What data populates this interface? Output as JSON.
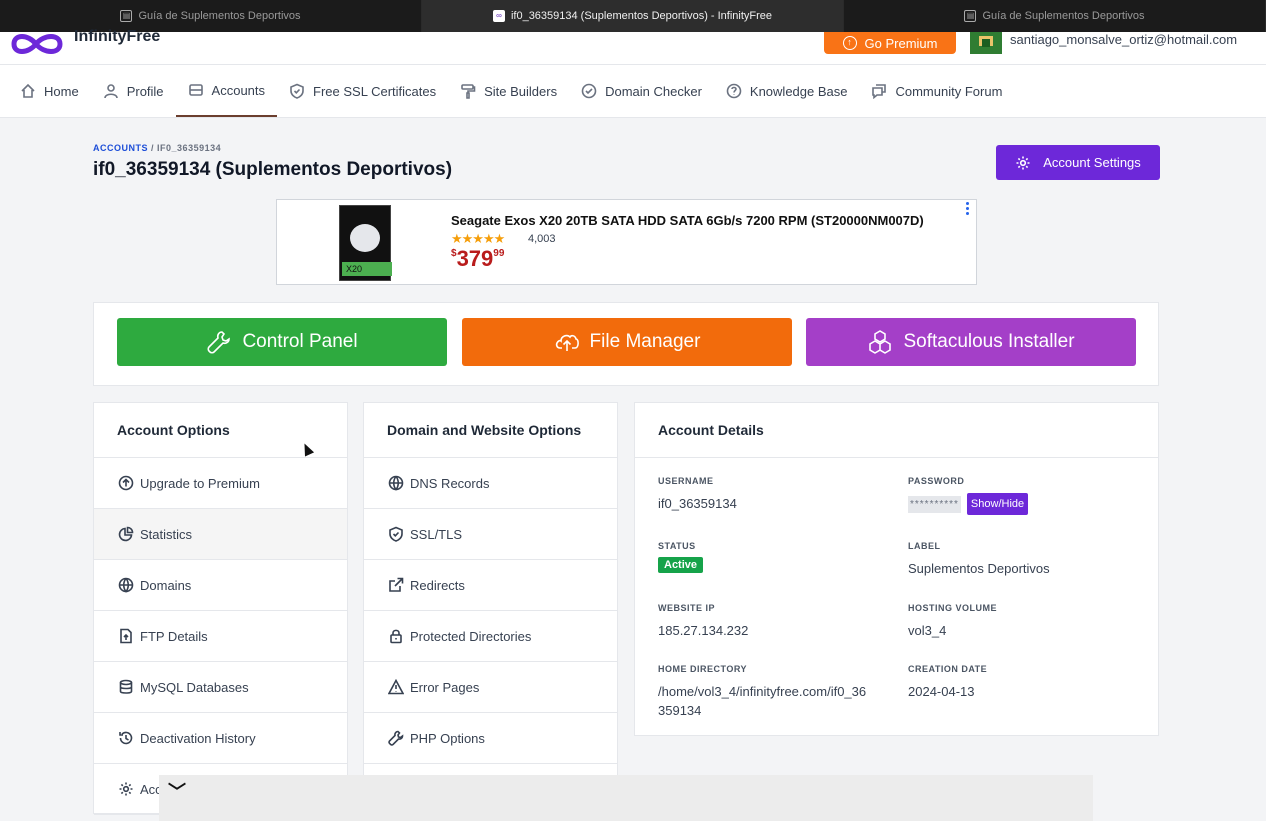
{
  "browser": {
    "tabs": [
      {
        "label": "Guía de Suplementos Deportivos"
      },
      {
        "label": "if0_36359134 (Suplementos Deportivos) - InfinityFree"
      },
      {
        "label": "Guía de Suplementos Deportivos"
      }
    ]
  },
  "header": {
    "brand": "InfinityFree",
    "premium_label": "Go Premium",
    "user_email": "santiago_monsalve_ortiz@hotmail.com"
  },
  "nav": {
    "items": [
      {
        "label": "Home",
        "icon": "home-icon"
      },
      {
        "label": "Profile",
        "icon": "user-icon"
      },
      {
        "label": "Accounts",
        "icon": "server-icon"
      },
      {
        "label": "Free SSL Certificates",
        "icon": "shield-icon"
      },
      {
        "label": "Site Builders",
        "icon": "paint-roller-icon"
      },
      {
        "label": "Domain Checker",
        "icon": "check-circle-icon"
      },
      {
        "label": "Knowledge Base",
        "icon": "question-circle-icon"
      },
      {
        "label": "Community Forum",
        "icon": "chat-icon"
      }
    ],
    "active": "Accounts"
  },
  "page": {
    "breadcrumb_root": "ACCOUNTS",
    "breadcrumb_sep": "/",
    "breadcrumb_current": "IF0_36359134",
    "title": "if0_36359134 (Suplementos Deportivos)",
    "settings_label": "Account Settings"
  },
  "ad": {
    "title": "Seagate Exos X20 20TB SATA HDD SATA 6Gb/s 7200 RPM (ST20000NM007D)",
    "stars": "★★★★★",
    "rating_count": "4,003",
    "price_symbol": "$",
    "price_whole": "379",
    "price_cents": "99"
  },
  "actions": {
    "control_panel": "Control Panel",
    "file_manager": "File Manager",
    "softaculous": "Softaculous Installer"
  },
  "account_options": {
    "heading": "Account Options",
    "items": [
      {
        "label": "Upgrade to Premium",
        "icon": "arrow-up-circle-icon"
      },
      {
        "label": "Statistics",
        "icon": "pie-chart-icon"
      },
      {
        "label": "Domains",
        "icon": "globe-icon"
      },
      {
        "label": "FTP Details",
        "icon": "file-upload-icon"
      },
      {
        "label": "MySQL Databases",
        "icon": "database-icon"
      },
      {
        "label": "Deactivation History",
        "icon": "history-icon"
      },
      {
        "label": "Acc",
        "icon": "gear-icon"
      }
    ]
  },
  "domain_options": {
    "heading": "Domain and Website Options",
    "items": [
      {
        "label": "DNS Records",
        "icon": "globe-icon"
      },
      {
        "label": "SSL/TLS",
        "icon": "shield-icon"
      },
      {
        "label": "Redirects",
        "icon": "external-link-icon"
      },
      {
        "label": "Protected Directories",
        "icon": "lock-icon"
      },
      {
        "label": "Error Pages",
        "icon": "warning-icon"
      },
      {
        "label": "PHP Options",
        "icon": "wrench-icon"
      }
    ]
  },
  "account_details": {
    "heading": "Account Details",
    "username_label": "USERNAME",
    "username": "if0_36359134",
    "password_label": "PASSWORD",
    "password_mask": "**********",
    "show_hide": "Show/Hide",
    "status_label": "STATUS",
    "status": "Active",
    "label_label": "LABEL",
    "label": "Suplementos Deportivos",
    "ip_label": "WEBSITE IP",
    "ip": "185.27.134.232",
    "volume_label": "HOSTING VOLUME",
    "volume": "vol3_4",
    "home_label": "HOME DIRECTORY",
    "home_line1": "/home/vol3_4/infinityfree.com/if0_36",
    "home_line2": "359134",
    "created_label": "CREATION DATE",
    "created": "2024-04-13"
  },
  "overlay": {
    "chevron": "﹀"
  },
  "colors": {
    "accent_purple": "#6d28d9",
    "control_panel": "#2eaa3f",
    "file_manager": "#f26b0c",
    "softaculous": "#a43fc8",
    "premium": "#f97316",
    "status_active": "#16a34a"
  }
}
